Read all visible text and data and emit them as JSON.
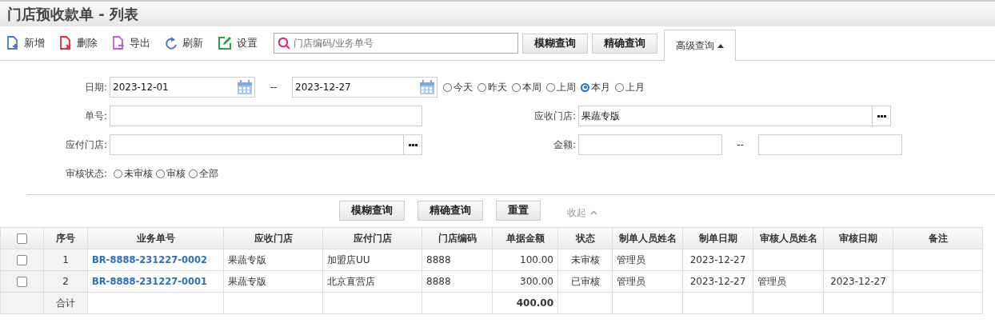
{
  "title": "门店预收款单 - 列表",
  "toolbar": {
    "actions": [
      {
        "label": "新增",
        "kind": "add"
      },
      {
        "label": "删除",
        "kind": "delete"
      },
      {
        "label": "导出",
        "kind": "export"
      },
      {
        "label": "刷新",
        "kind": "refresh"
      },
      {
        "label": "设置",
        "kind": "settings"
      }
    ],
    "search": {
      "placeholder": "门店编码/业务单号"
    },
    "buttons": [
      "模糊查询",
      "精确查询"
    ],
    "advanced_tab": {
      "label": "高级查询",
      "selected": true,
      "expanded": true
    }
  },
  "filters": {
    "date": {
      "label": "日期:",
      "from": "2023-12-01",
      "separator": "--",
      "to": "2023-12-27"
    },
    "quick_ranges": [
      {
        "label": "今天",
        "selected": false
      },
      {
        "label": "昨天",
        "selected": false
      },
      {
        "label": "本周",
        "selected": false
      },
      {
        "label": "上周",
        "selected": false
      },
      {
        "label": "本月",
        "selected": true
      },
      {
        "label": "上月",
        "selected": false
      }
    ],
    "order_no": {
      "label": "单号:"
    },
    "receiving_store": {
      "label": "应收门店:",
      "value": "果蔬专版"
    },
    "paying_store": {
      "label": "应付门店:"
    },
    "amount": {
      "label": "金额:",
      "separator": "--"
    },
    "audit_status": {
      "label": "审核状态:",
      "options": [
        {
          "label": "未审核",
          "selected": false
        },
        {
          "label": "审核",
          "selected": false
        },
        {
          "label": "全部",
          "selected": false
        }
      ]
    },
    "buttons": [
      "模糊查询",
      "精确查询",
      "重置"
    ],
    "collapse": {
      "label": "收起"
    }
  },
  "table": {
    "header_checked": false,
    "columns": [
      "序号",
      "业务单号",
      "应收门店",
      "应付门店",
      "门店编码",
      "单据金额",
      "状态",
      "制单人员姓名",
      "制单日期",
      "审核人员姓名",
      "审核日期",
      "备注"
    ],
    "rows": [
      {
        "checked": false,
        "no": "1",
        "doc_no": "BR-8888-231227-0002",
        "receiving": "果蔬专版",
        "paying": "加盟店UU",
        "code": "8888",
        "amount": "100.00",
        "status": "未审核",
        "creator": "管理员",
        "created": "2023-12-27"
      },
      {
        "checked": false,
        "no": "2",
        "doc_no": "BR-8888-231227-0001",
        "receiving": "果蔬专版",
        "paying": "北京直营店",
        "code": "8888",
        "amount": "300.00",
        "status": "已审核",
        "creator": "管理员",
        "created": "2023-12-27",
        "auditor": "管理员",
        "audit_date": "2023-12-27"
      }
    ],
    "footer": {
      "label": "合计",
      "total": "400.00"
    }
  }
}
